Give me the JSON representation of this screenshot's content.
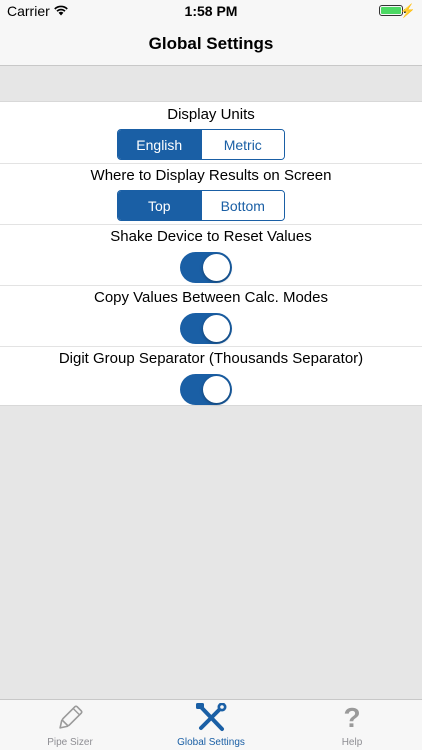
{
  "status_bar": {
    "carrier": "Carrier",
    "time": "1:58 PM"
  },
  "nav": {
    "title": "Global Settings"
  },
  "settings": {
    "display_units": {
      "label": "Display Units",
      "options": [
        "English",
        "Metric"
      ],
      "selected": "English"
    },
    "results_position": {
      "label": "Where to Display Results on Screen",
      "options": [
        "Top",
        "Bottom"
      ],
      "selected": "Top"
    },
    "shake_reset": {
      "label": "Shake Device to Reset Values",
      "on": true
    },
    "copy_values": {
      "label": "Copy Values Between Calc. Modes",
      "on": true
    },
    "digit_separator": {
      "label": "Digit Group Separator (Thousands Separator)",
      "on": true
    }
  },
  "tabs": [
    {
      "label": "Pipe Sizer",
      "icon": "pencil-icon",
      "active": false
    },
    {
      "label": "Global Settings",
      "icon": "tools-icon",
      "active": true
    },
    {
      "label": "Help",
      "icon": "question-icon",
      "active": false
    }
  ],
  "colors": {
    "accent": "#1a5fa5",
    "battery": "#4cd964",
    "background": "#e6e6e6"
  }
}
